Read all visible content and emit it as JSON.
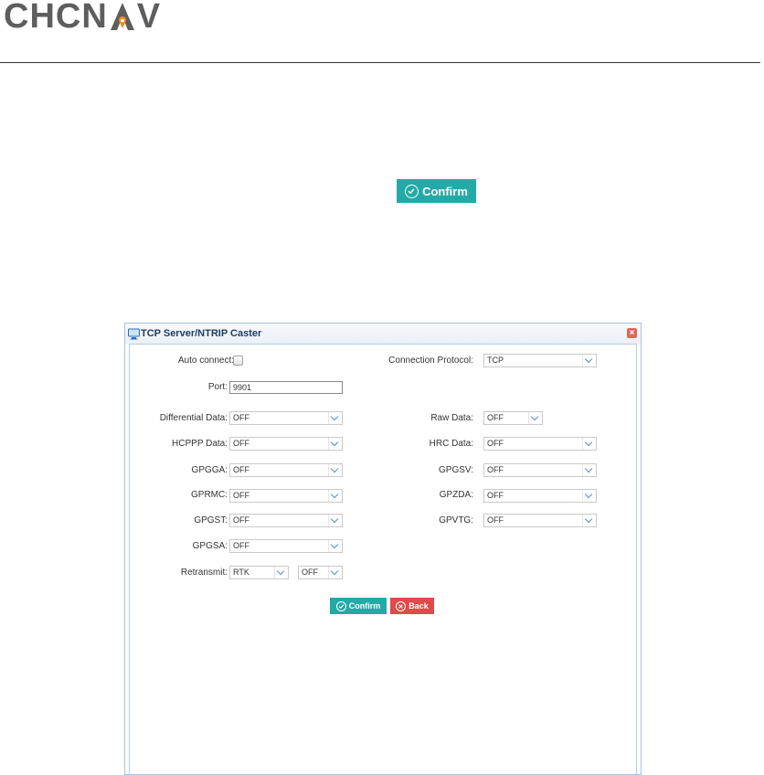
{
  "header": {
    "logo_text_1": "CHCN",
    "logo_text_2": "V"
  },
  "doc": {
    "confirm_label": "Confirm"
  },
  "dialog": {
    "title": "TCP Server/NTRIP Caster",
    "auto_connect": {
      "label": "Auto connect:",
      "checked": false
    },
    "connection_protocol": {
      "label": "Connection Protocol:",
      "value": "TCP"
    },
    "port": {
      "label": "Port:",
      "value": "9901"
    },
    "differential_data": {
      "label": "Differential Data:",
      "value": "OFF"
    },
    "raw_data": {
      "label": "Raw Data:",
      "value": "OFF"
    },
    "hcppp_data": {
      "label": "HCPPP Data:",
      "value": "OFF"
    },
    "hrc_data": {
      "label": "HRC Data:",
      "value": "OFF"
    },
    "gpgga": {
      "label": "GPGGA:",
      "value": "OFF"
    },
    "gpgsv": {
      "label": "GPGSV:",
      "value": "OFF"
    },
    "gprmc": {
      "label": "GPRMC:",
      "value": "OFF"
    },
    "gpzda": {
      "label": "GPZDA:",
      "value": "OFF"
    },
    "gpgst": {
      "label": "GPGST:",
      "value": "OFF"
    },
    "gpvtg": {
      "label": "GPVTG:",
      "value": "OFF"
    },
    "gpgsa": {
      "label": "GPGSA:",
      "value": "OFF"
    },
    "retransmit": {
      "label": "Retransmit:",
      "source": "RTK",
      "value": "OFF"
    },
    "confirm_label": "Confirm",
    "back_label": "Back"
  },
  "colors": {
    "confirm": "#23aaa7",
    "back": "#e14a4a",
    "logo_gray": "#5e5e5e",
    "logo_orange": "#f08a24"
  },
  "icons": {
    "title": "monitor-icon",
    "close": "close-icon",
    "confirm": "check-circle-icon",
    "back": "x-circle-icon"
  }
}
